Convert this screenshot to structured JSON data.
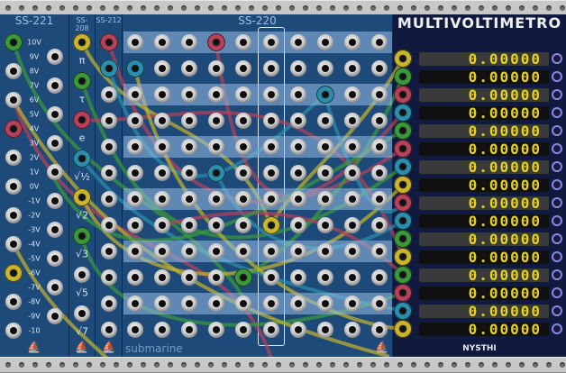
{
  "modules": {
    "ss221": {
      "title": "SS-221",
      "left_labels": [
        "10V",
        "9V",
        "8V",
        "7V",
        "6V",
        "5V",
        "4V",
        "3V",
        "2V",
        "1V",
        "0V",
        "-1V",
        "-2V",
        "-3V",
        "-4V",
        "-5V",
        "-6V",
        "-7V",
        "-8V",
        "-9V",
        "-10"
      ]
    },
    "ss208": {
      "title": "SS-208",
      "labels": [
        "π",
        "τ",
        "e",
        "√½",
        "√2",
        "√3",
        "√5",
        "√7"
      ]
    },
    "ss212": {
      "title": "SS-212"
    },
    "ss220": {
      "title": "SS-220",
      "footer": "submarine"
    },
    "multivoltmeter": {
      "title": "MULTIVOLTIMETRO",
      "brand": "NYSTHI",
      "readings": [
        "0.00000",
        "0.00000",
        "0.00000",
        "0.00000",
        "0.00000",
        "0.00000",
        "0.00000",
        "0.00000",
        "0.00000",
        "0.00000",
        "0.00000",
        "0.00000",
        "0.00000",
        "0.00000",
        "0.00000",
        "0.00000"
      ]
    }
  },
  "colors": {
    "panel": "#1d4a78",
    "cable_yellow": "#c9b42a",
    "cable_green": "#3a9a3a",
    "cable_red": "#b8405a",
    "cable_teal": "#2a8fae",
    "display_digits": "#e6d21c"
  },
  "icons": [
    "submarine-icon"
  ]
}
